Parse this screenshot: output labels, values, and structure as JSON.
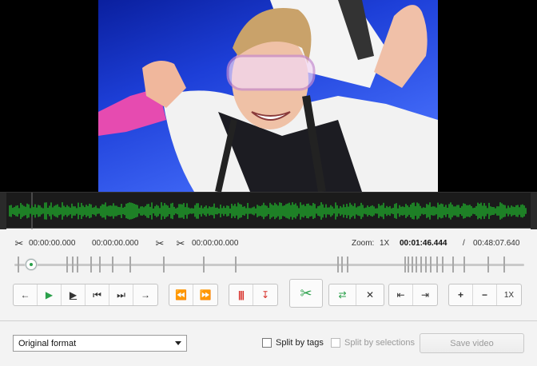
{
  "video": {
    "description_icon": "video-frame"
  },
  "timeline_info": {
    "selection_start": "00:00:00.000",
    "selection_end": "00:00:00.000",
    "cut_start": "00:00:00.000",
    "zoom_label": "Zoom:",
    "zoom_value": "1X",
    "current_time": "00:01:46.444",
    "separator": "/",
    "total_time": "00:48:07.640",
    "playhead_fraction": 0.0
  },
  "controls": {
    "zoom_reset_label": "1X"
  },
  "bottom": {
    "format_selected": "Original format",
    "split_by_tags": "Split by tags",
    "split_by_selections": "Split by selections",
    "save_label": "Save video"
  },
  "colors": {
    "waveform": "#1fa32a",
    "play": "#2aa04a",
    "split_marker": "#d8302a"
  }
}
